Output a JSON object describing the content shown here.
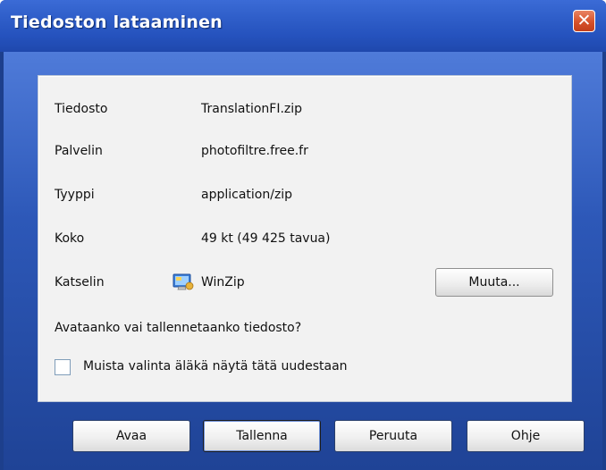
{
  "window": {
    "title": "Tiedoston lataaminen",
    "close_label": "✕"
  },
  "details": {
    "file_label": "Tiedosto",
    "file_value": "TranslationFI.zip",
    "server_label": "Palvelin",
    "server_value": "photofiltre.free.fr",
    "type_label": "Tyyppi",
    "type_value": "application/zip",
    "size_label": "Koko",
    "size_value": "49 kt (49 425 tavua)",
    "viewer_label": "Katselin",
    "viewer_value": "WinZip",
    "viewer_icon": "winzip-icon",
    "change_label": "Muuta..."
  },
  "question": "Avataanko vai tallennetaanko tiedosto?",
  "remember": {
    "label": "Muista valinta äläkä näytä tätä uudestaan",
    "checked": false
  },
  "buttons": {
    "open": "Avaa",
    "save": "Tallenna",
    "cancel": "Peruuta",
    "help": "Ohje"
  },
  "colors": {
    "title_bar": "#2552bd",
    "close_button": "#d6512b",
    "panel": "#f2f2f2"
  }
}
